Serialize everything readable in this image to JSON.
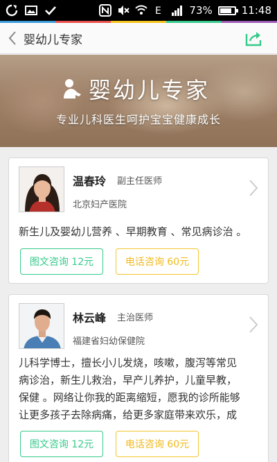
{
  "status_bar": {
    "battery_percent": "73%",
    "time": "11:48",
    "icons": [
      "sync-icon",
      "image-icon",
      "check-icon",
      "nfc-icon",
      "mute-icon",
      "wifi-icon",
      "data-icon",
      "signal-icon",
      "battery-icon"
    ],
    "battery_level": 0.73
  },
  "header": {
    "title": "婴幼儿专家"
  },
  "banner": {
    "title": "婴幼儿专家",
    "subtitle": "专业儿科医生呵护宝宝健康成长"
  },
  "doctors": [
    {
      "name": "温春玲",
      "title": "副主任医师",
      "hospital": "北京妇产医院",
      "description": "新生儿及婴幼儿营养 、早期教育 、常见病诊治 。",
      "text_consult": "图文咨询 12元",
      "phone_consult": "电话咨询 60元"
    },
    {
      "name": "林云峰",
      "title": "主治医师",
      "hospital": "福建省妇幼保健院",
      "description_lines": [
        "儿科学博士，擅长小儿发烧，咳嗽，腹泻等常见",
        "病诊治，新生儿救治，早产儿养护，儿童早教，",
        "保健 。网络让你我的距离缩短，愿我的诊所能够",
        "让更多孩子去除病痛，给更多家庭带来欢乐，成"
      ],
      "text_consult": "图文咨询 12元",
      "phone_consult": "电话咨询 60元"
    }
  ],
  "colors": {
    "green": "#35c98a",
    "yellow": "#f4c62f"
  }
}
